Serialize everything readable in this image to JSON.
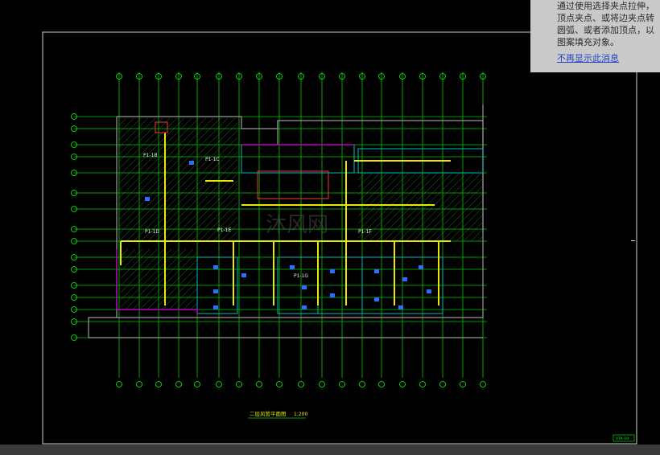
{
  "drawing": {
    "title": "二层风管平面图",
    "scale": "1:200",
    "titleblock": "VTA-19"
  },
  "tooltip": {
    "lines": [
      "通过使用选择夹点拉伸，",
      "顶点夹点、或将边夹点转",
      "圆弧、或者添加顶点，以",
      "图案填充对象。"
    ],
    "dismiss_link": "不再显示此消息"
  },
  "zones": [
    "P1-1B",
    "P1-1C",
    "P1-1D",
    "P1-1E",
    "P1-1F",
    "P1-1G"
  ],
  "colors": {
    "background": "#000000",
    "grid": "#00ff00",
    "duct": "#ffff00",
    "wall": "#808080",
    "cyan": "#00bfbf",
    "magenta": "#c000c0",
    "highlight": "#d03030"
  }
}
